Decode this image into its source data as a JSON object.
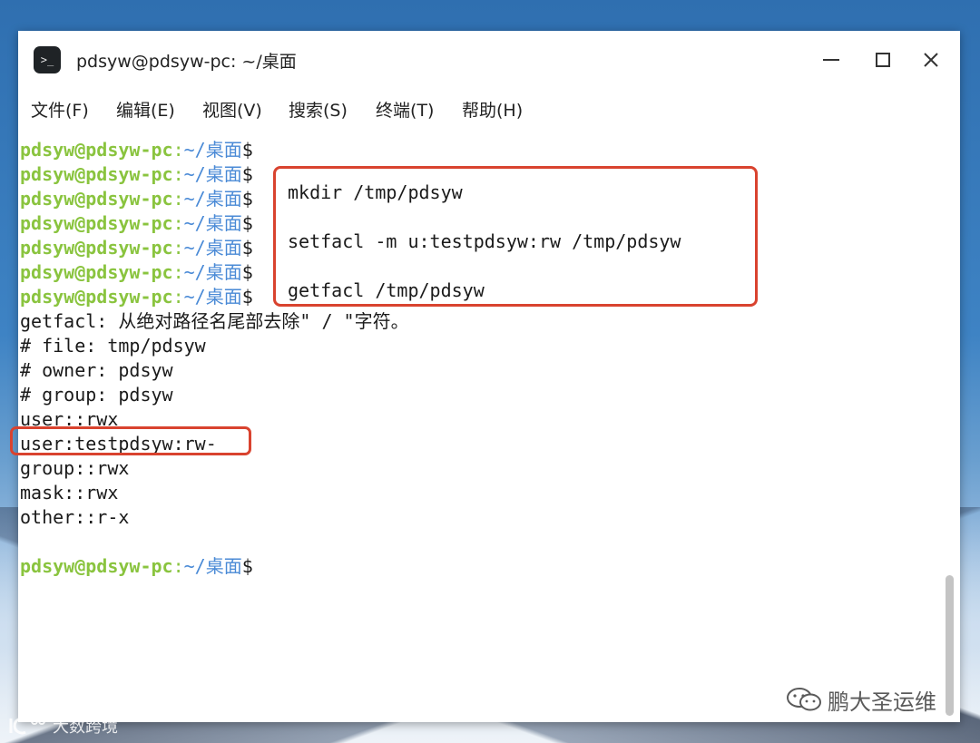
{
  "window": {
    "title": "pdsyw@pdsyw-pc: ~/桌面",
    "app_icon_glyph": ">_"
  },
  "menu": [
    {
      "label": "文件(F)"
    },
    {
      "label": "编辑(E)"
    },
    {
      "label": "视图(V)"
    },
    {
      "label": "搜索(S)"
    },
    {
      "label": "终端(T)"
    },
    {
      "label": "帮助(H)"
    }
  ],
  "prompt": {
    "user": "pdsyw@pdsyw-pc",
    "colon": ":",
    "path": "~/桌面",
    "dollar": "$"
  },
  "callout": {
    "cmd1": "mkdir /tmp/pdsyw",
    "cmd2": "setfacl -m u:testpdsyw:rw /tmp/pdsyw",
    "cmd3": "getfacl /tmp/pdsyw"
  },
  "output": [
    "getfacl: 从绝对路径名尾部去除\" / \"字符。",
    "# file: tmp/pdsyw",
    "# owner: pdsyw",
    "# group: pdsyw",
    "user::rwx",
    "user:testpdsyw:rw-",
    "group::rwx",
    "mask::rwx",
    "other::r-x"
  ],
  "watermarks": {
    "right": "鹏大圣运维",
    "left": "大数跨境"
  },
  "colors": {
    "prompt_user": "#8ac43f",
    "prompt_path": "#4a8ad6",
    "callout_border": "#d9432f"
  }
}
